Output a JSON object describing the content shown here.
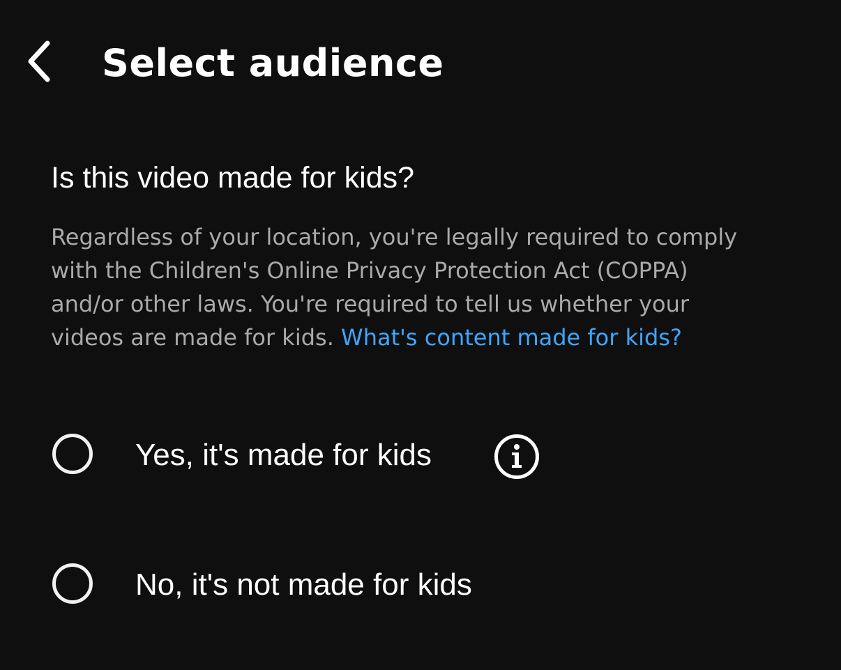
{
  "header": {
    "title": "Select audience",
    "back_icon": "chevron-left-icon"
  },
  "question": "Is this video made for kids?",
  "description": {
    "lines": [
      "Regardless of your location, you're legally required to comply",
      "with the Children's Online Privacy Protection Act (COPPA)",
      "and/or other laws. You're required to tell us whether your",
      "videos are made for kids. "
    ],
    "link_text": "What's content made for kids?"
  },
  "options": [
    {
      "label": "Yes, it's made for kids",
      "selected": false,
      "info_icon": "info-icon"
    },
    {
      "label": "No, it's not made for kids",
      "selected": false
    }
  ],
  "colors": {
    "background": "#0f0f0f",
    "text_primary": "#ffffff",
    "text_secondary": "#aaaaaa",
    "link": "#3ea6ff"
  }
}
